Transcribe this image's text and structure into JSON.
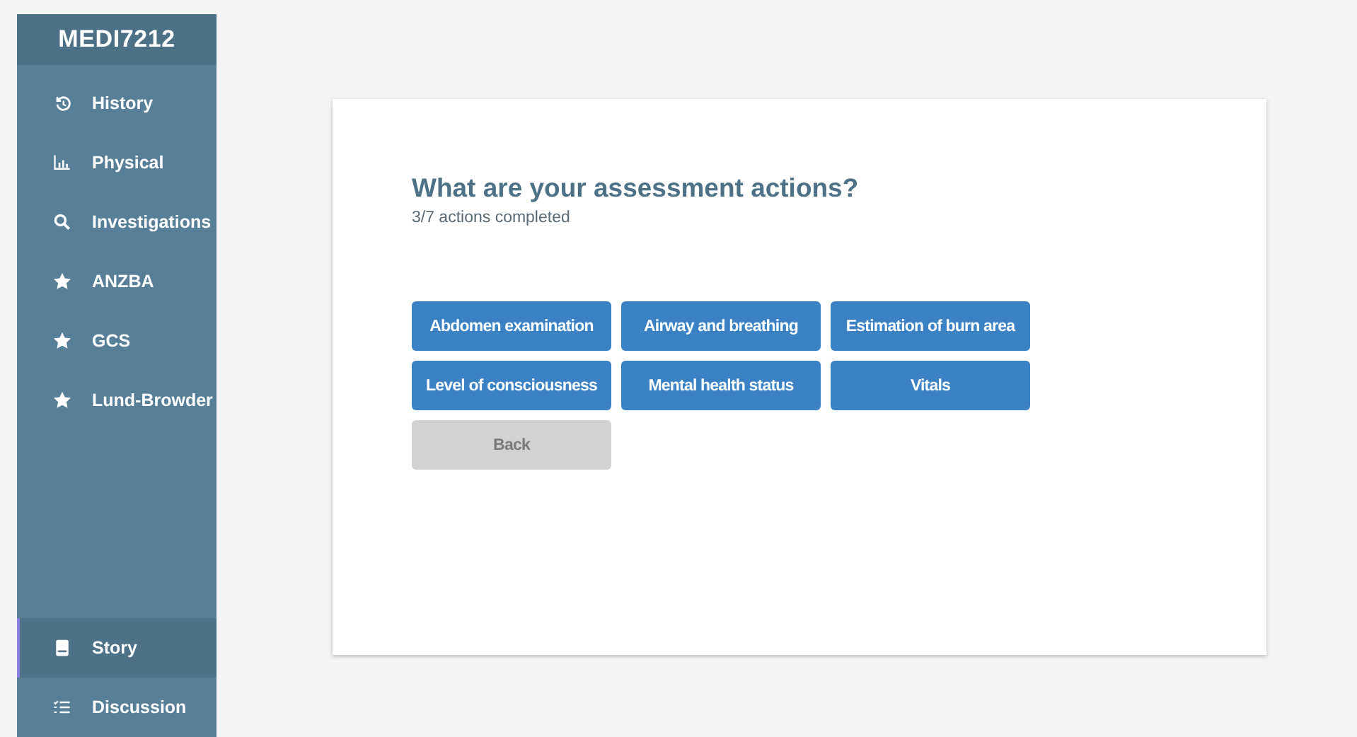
{
  "sidebar": {
    "title": "MEDI7212",
    "items": [
      {
        "label": "History",
        "kind": "history",
        "selected": false
      },
      {
        "label": "Physical",
        "kind": "chart",
        "selected": false
      },
      {
        "label": "Investigations",
        "kind": "search",
        "selected": false
      },
      {
        "label": "ANZBA",
        "kind": "star",
        "selected": false
      },
      {
        "label": "GCS",
        "kind": "star",
        "selected": false
      },
      {
        "label": "Lund-Browder",
        "kind": "star",
        "selected": false
      }
    ],
    "bottom_items": [
      {
        "label": "Story",
        "kind": "book",
        "selected": true
      },
      {
        "label": "Discussion",
        "kind": "list",
        "selected": false
      }
    ]
  },
  "question": {
    "title": "What are your assessment actions?",
    "progress": "3/7 actions completed",
    "actions": [
      {
        "label": "Abdomen examination",
        "disabled": false
      },
      {
        "label": "Airway and breathing",
        "disabled": false
      },
      {
        "label": "Estimation of burn area",
        "disabled": false
      },
      {
        "label": "Level of consciousness",
        "disabled": false
      },
      {
        "label": "Mental health status",
        "disabled": false
      },
      {
        "label": "Vitals",
        "disabled": false
      },
      {
        "label": "Back",
        "disabled": true
      }
    ]
  }
}
